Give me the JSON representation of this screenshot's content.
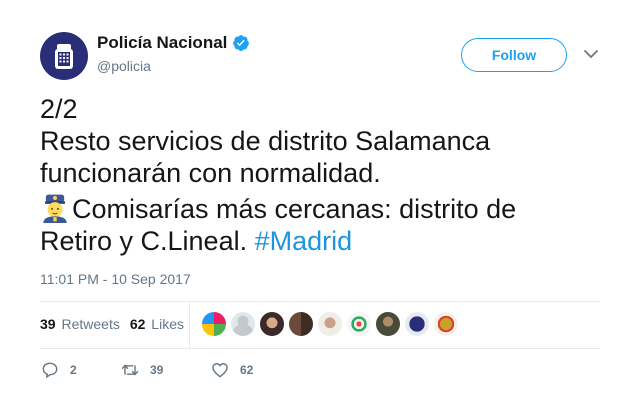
{
  "author": {
    "display_name": "Policía Nacional",
    "handle": "@policia",
    "verified": true
  },
  "follow_button": {
    "label": "Follow"
  },
  "tweet": {
    "lines": [
      "2/2",
      "Resto servicios de distrito Salamanca",
      "funcionarán con normalidad."
    ],
    "line4_text": "Comisarías más cercanas: distrito de",
    "line5_text": "Retiro y C.Lineal. ",
    "hashtag": "#Madrid",
    "emoji": "police-officer-emoji"
  },
  "timestamp": "11:01 PM - 10 Sep 2017",
  "stats": {
    "retweets_count": "39",
    "retweets_label": "Retweets",
    "likes_count": "62",
    "likes_label": "Likes"
  },
  "likers": [
    "liker-avatar-1",
    "liker-avatar-2",
    "liker-avatar-3",
    "liker-avatar-4",
    "liker-avatar-5",
    "liker-avatar-6",
    "liker-avatar-7",
    "liker-avatar-8",
    "liker-avatar-9"
  ],
  "actions": {
    "reply_count": "2",
    "retweet_count": "39",
    "like_count": "62"
  },
  "colors": {
    "accent": "#1da1f2",
    "hashtag": "#1b95e0",
    "muted": "#657786",
    "text": "#14171a"
  }
}
